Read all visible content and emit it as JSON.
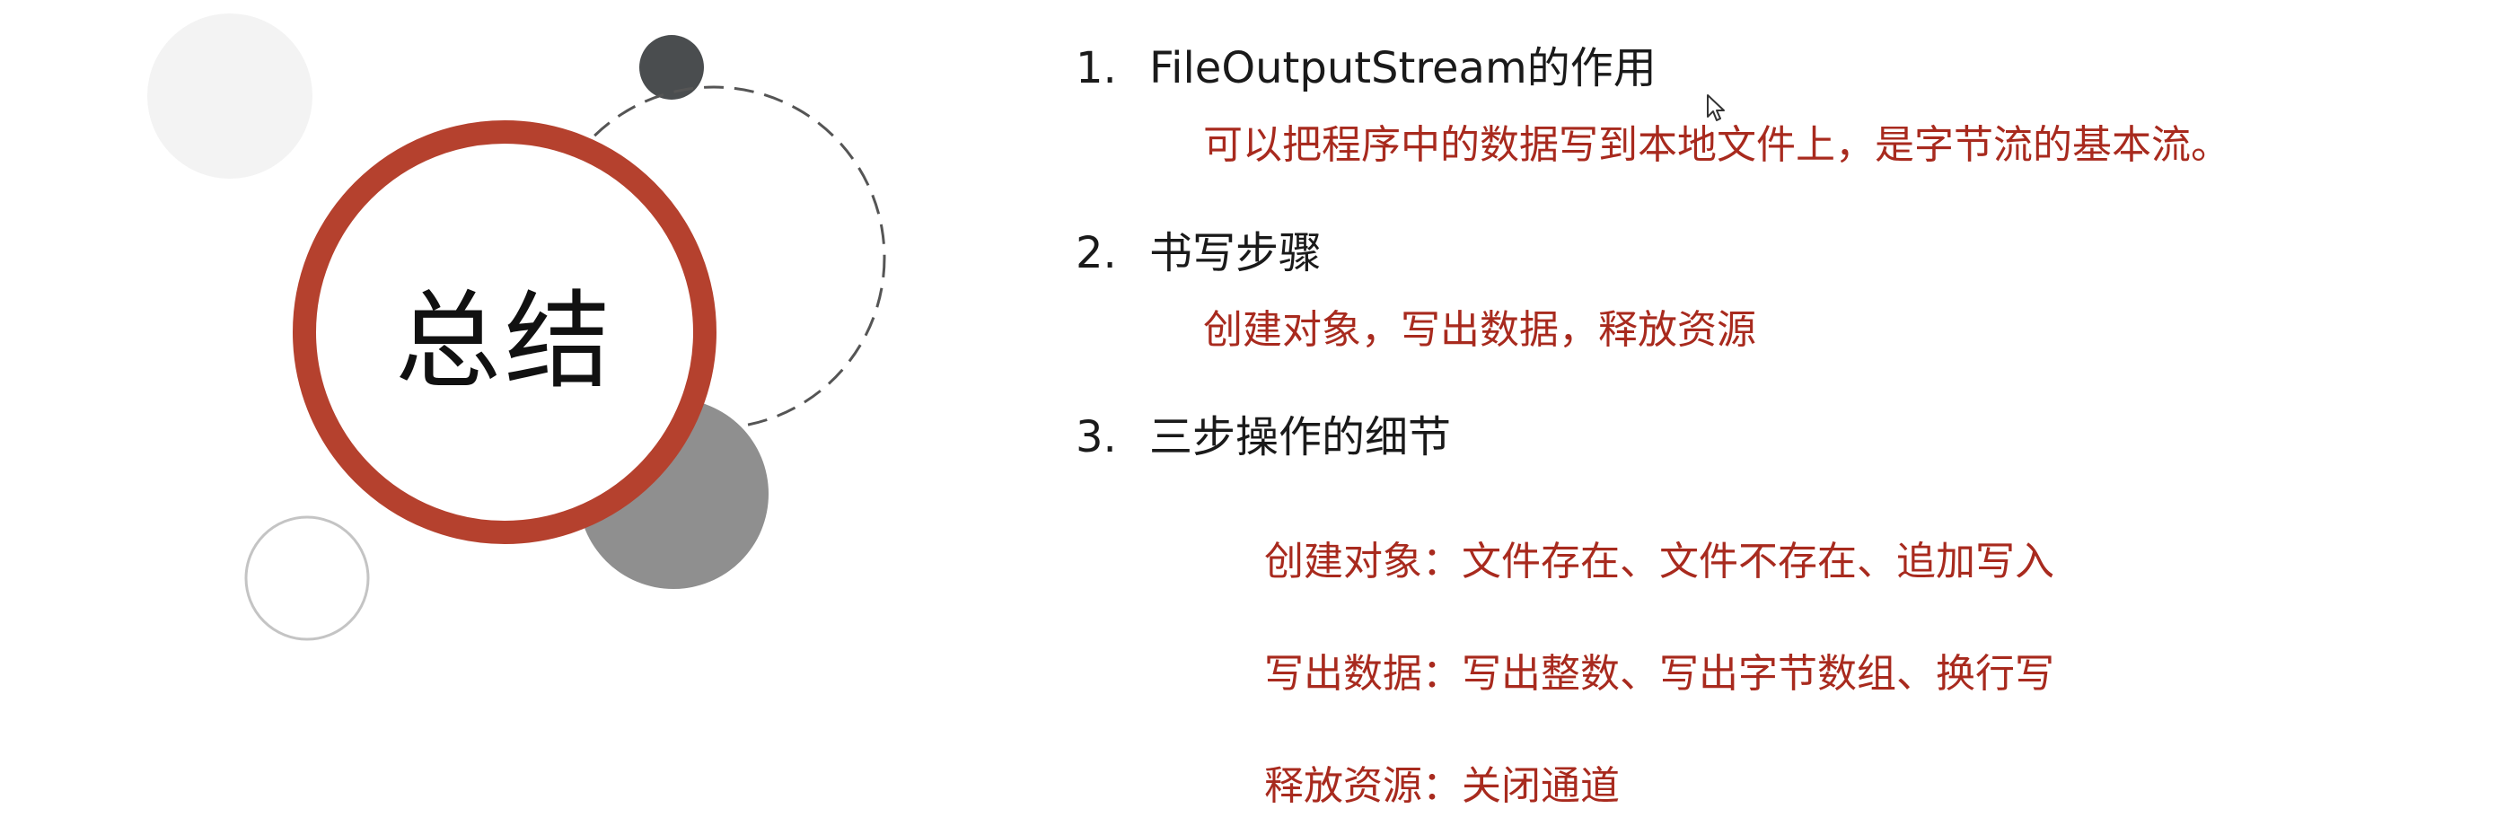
{
  "slide": {
    "title": "总结",
    "items": [
      {
        "number": "1.",
        "heading": "FileOutputStream的作用",
        "details": [
          "可以把程序中的数据写到本地文件上，是字节流的基本流。"
        ]
      },
      {
        "number": "2.",
        "heading": "书写步骤",
        "details": [
          "创建对象，写出数据，释放资源"
        ]
      },
      {
        "number": "3.",
        "heading": "三步操作的细节",
        "details": [
          "创建对象：文件存在、文件不存在、追加写入",
          "写出数据：写出整数、写出字节数组、换行写",
          "释放资源：关闭通道"
        ]
      }
    ]
  },
  "colors": {
    "accent_red": "#a82a1e",
    "ring_red": "#b5412e",
    "dark_dot": "#4a4d4f",
    "gray_circle": "#8f8f8f",
    "light_circle": "#f3f3f3"
  },
  "icons": [
    "mouse-cursor-icon"
  ]
}
